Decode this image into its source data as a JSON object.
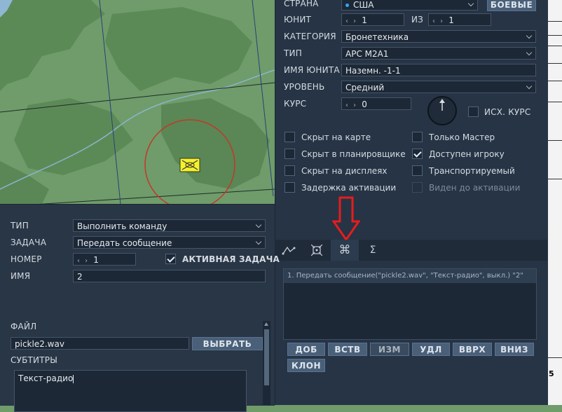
{
  "colors": {
    "map_land": "#6f9c6a",
    "map_dark": "#5c8a57",
    "panel_bg": "#283646",
    "field_bg": "#1c2836",
    "button_bg": "#4a6079",
    "zone_ring": "#c0392b",
    "unit_marker": "#f5f12a",
    "arrow_red": "#e81c1c",
    "country_dot": "#2ea8ff"
  },
  "map": {
    "unit_icon": "envelope-icon"
  },
  "unit_panel": {
    "country_label": "СТРАНА",
    "country_value": "США",
    "combat_button": "БОЕВЫЕ",
    "unit_label": "ЮНИТ",
    "unit_value": "1",
    "of_label": "ИЗ",
    "of_value": "1",
    "category_label": "КАТЕГОРИЯ",
    "category_value": "Бронетехника",
    "type_label": "ТИП",
    "type_value": "APC M2A1",
    "name_label": "ИМЯ ЮНИТА",
    "name_value": "Наземн. -1-1",
    "level_label": "УРОВЕНЬ",
    "level_value": "Средний",
    "heading_label": "КУРС",
    "heading_value": "0",
    "initial_heading_label": "ИСХ. КУРС",
    "checkboxes": [
      {
        "label": "Скрыт на карте",
        "checked": false,
        "disabled": false
      },
      {
        "label": "Только Мастер",
        "checked": false,
        "disabled": false
      },
      {
        "label": "Скрыт в планировщике",
        "checked": false,
        "disabled": false
      },
      {
        "label": "Доступен игроку",
        "checked": true,
        "disabled": false
      },
      {
        "label": "Скрыт на дисплеях",
        "checked": false,
        "disabled": false
      },
      {
        "label": "Транспортируемый",
        "checked": false,
        "disabled": false
      },
      {
        "label": "Задержка активации",
        "checked": false,
        "disabled": false
      },
      {
        "label": "Виден до активации",
        "checked": false,
        "disabled": true
      }
    ]
  },
  "tabs": [
    {
      "icon": "route-icon",
      "glyph": "⩘"
    },
    {
      "icon": "target-icon",
      "glyph": "⌖"
    },
    {
      "icon": "command-icon",
      "glyph": "⌘"
    },
    {
      "icon": "sigma-icon",
      "glyph": "Σ"
    }
  ],
  "actions_list": {
    "items": [
      "1. Передать сообщение(\"pickle2.wav\", \"Текст-радио\", выкл.) \"2\""
    ]
  },
  "action_buttons": {
    "add": "ДОБ",
    "insert": "ВСТВ",
    "edit": "ИЗМ",
    "delete": "УДЛ",
    "up": "ВВРХ",
    "down": "ВНИЗ",
    "clone": "КЛОН"
  },
  "task_panel": {
    "type_label": "ТИП",
    "type_value": "Выполнить команду",
    "task_label": "ЗАДАЧА",
    "task_value": "Передать сообщение",
    "number_label": "НОМЕР",
    "number_value": "1",
    "active_task_label": "АКТИВНАЯ ЗАДАЧА",
    "name_label": "ИМЯ",
    "name_value": "2",
    "file_label": "ФАЙЛ",
    "file_value": "pickle2.wav",
    "choose_button": "ВЫБРАТЬ",
    "subtitles_label": "СУБТИТРЫ",
    "subtitles_value": "Текст-радио"
  },
  "doc_strip_text": "5"
}
